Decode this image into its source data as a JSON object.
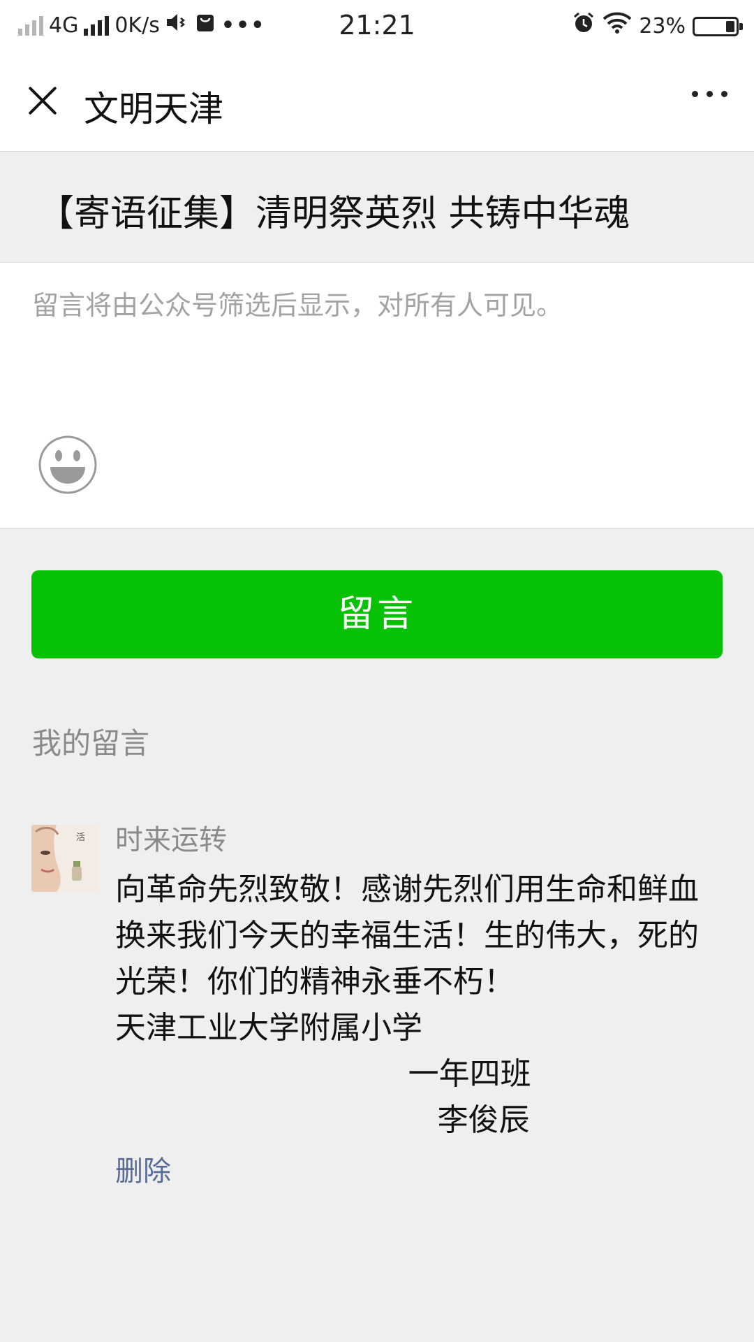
{
  "status_bar": {
    "network": "4G",
    "speed": "0K/s",
    "time": "21:21",
    "battery": "23%",
    "battery_level": 0.23
  },
  "nav": {
    "title": "文明天津"
  },
  "article": {
    "title": "【寄语征集】清明祭英烈 共铸中华魂"
  },
  "input": {
    "placeholder": "留言将由公众号筛选后显示，对所有人可见。"
  },
  "submit_label": "留言",
  "my_comments_label": "我的留言",
  "comment": {
    "user": "时来运转",
    "text": "向革命先烈致敬！感谢先烈们用生命和鲜血换来我们今天的幸福生活！生的伟大，死的光荣！你们的精神永垂不朽！                         天津工业大学附属小学\n                              一年四班\n                                 李俊辰",
    "delete_label": "删除"
  },
  "colors": {
    "accent_green": "#07c107",
    "link_blue": "#576b95",
    "background": "#efefef"
  }
}
